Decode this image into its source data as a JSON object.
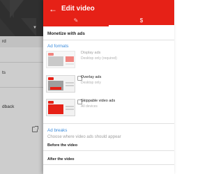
{
  "background_app": {
    "menu_items": [
      "rd",
      "ts",
      "dback"
    ]
  },
  "edit_panel": {
    "title": "Edit video",
    "back_icon": "arrow-left-icon",
    "tabs": [
      {
        "name": "edit",
        "icon": "pencil-icon",
        "glyph": "✎",
        "selected": false
      },
      {
        "name": "monetization",
        "icon": "dollar-icon",
        "glyph": "$",
        "selected": true
      }
    ],
    "monetize_label": "Monetize with ads",
    "ad_formats_header": "Ad formats",
    "ad_formats": [
      {
        "name": "Display ads",
        "subtitle": "Desktop only (required)",
        "enabled": false
      },
      {
        "name": "Overlay ads",
        "subtitle": "Desktop only",
        "enabled": true
      },
      {
        "name": "Skippable video ads",
        "subtitle": "All devices",
        "enabled": true
      }
    ],
    "ad_breaks_header": "Ad breaks",
    "ad_breaks_description": "Choose where video ads should appear",
    "before_video_label": "Before the video",
    "after_video_label": "After the video"
  },
  "colors": {
    "brand_red": "#e62117",
    "link_blue": "#3a8bdc"
  }
}
